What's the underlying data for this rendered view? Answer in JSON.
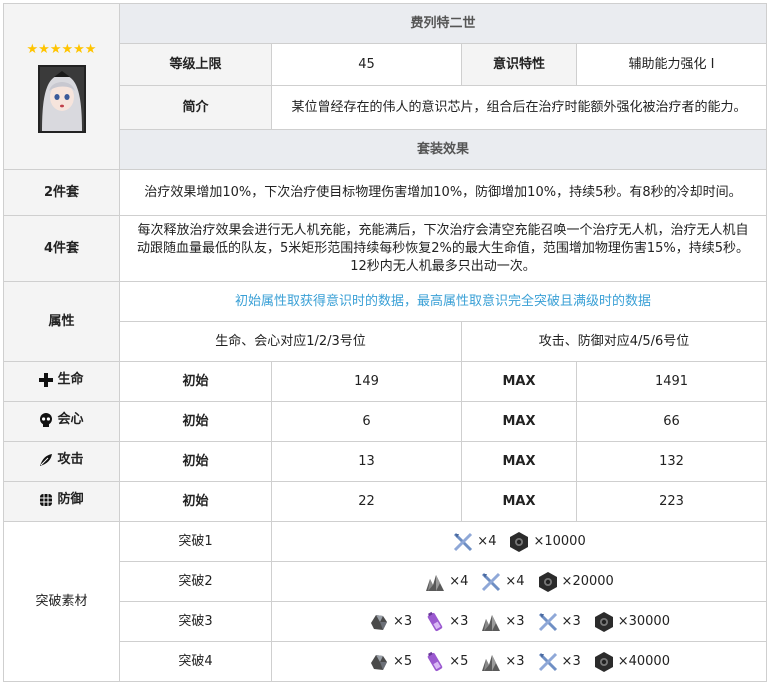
{
  "chip": {
    "name": "费列特二世",
    "stars": "★★★★★★",
    "level_cap_label": "等级上限",
    "level_cap_value": "45",
    "trait_label": "意识特性",
    "trait_value": "辅助能力强化 I",
    "intro_label": "简介",
    "intro_text": "某位曾经存在的伟人的意识芯片，组合后在治疗时能额外强化被治疗者的能力。"
  },
  "set_effect": {
    "header": "套装效果",
    "two_piece_label": "2件套",
    "two_piece_text": "治疗效果增加10%，下次治疗使目标物理伤害增加10%，防御增加10%，持续5秒。有8秒的冷却时间。",
    "four_piece_label": "4件套",
    "four_piece_text": "每次释放治疗效果会进行无人机充能，充能满后，下次治疗会清空充能召唤一个治疗无人机，治疗无人机自动跟随血量最低的队友，5米矩形范围持续每秒恢复2%的最大生命值，范围增加物理伤害15%，持续5秒。12秒内无人机最多只出动一次。"
  },
  "attributes": {
    "label": "属性",
    "note": "初始属性取获得意识时的数据，最高属性取意识完全突破且满级时的数据",
    "slots_left": "生命、会心对应1/2/3号位",
    "slots_right": "攻击、防御对应4/5/6号位",
    "initial_label": "初始",
    "max_label": "MAX",
    "stats": [
      {
        "name": "生命",
        "icon": "plus-icon",
        "initial": "149",
        "max": "1491"
      },
      {
        "name": "会心",
        "icon": "skull-icon",
        "initial": "6",
        "max": "66"
      },
      {
        "name": "攻击",
        "icon": "feather-icon",
        "initial": "13",
        "max": "132"
      },
      {
        "name": "防御",
        "icon": "shield-grid-icon",
        "initial": "22",
        "max": "223"
      }
    ]
  },
  "breakthrough": {
    "label": "突破素材",
    "rows": [
      {
        "name": "突破1",
        "materials": [
          {
            "icon": "blade-icon",
            "qty": "×4"
          },
          {
            "icon": "nut-icon",
            "qty": "×10000"
          }
        ]
      },
      {
        "name": "突破2",
        "materials": [
          {
            "icon": "ore-icon",
            "qty": "×4"
          },
          {
            "icon": "blade-icon",
            "qty": "×4"
          },
          {
            "icon": "nut-icon",
            "qty": "×20000"
          }
        ]
      },
      {
        "name": "突破3",
        "materials": [
          {
            "icon": "rock-icon",
            "qty": "×3"
          },
          {
            "icon": "battery-icon",
            "qty": "×3"
          },
          {
            "icon": "ore-icon",
            "qty": "×3"
          },
          {
            "icon": "blade-icon",
            "qty": "×3"
          },
          {
            "icon": "nut-icon",
            "qty": "×30000"
          }
        ]
      },
      {
        "name": "突破4",
        "materials": [
          {
            "icon": "rock-icon",
            "qty": "×5"
          },
          {
            "icon": "battery-icon",
            "qty": "×5"
          },
          {
            "icon": "ore-icon",
            "qty": "×3"
          },
          {
            "icon": "blade-icon",
            "qty": "×3"
          },
          {
            "icon": "nut-icon",
            "qty": "×40000"
          }
        ]
      }
    ]
  }
}
